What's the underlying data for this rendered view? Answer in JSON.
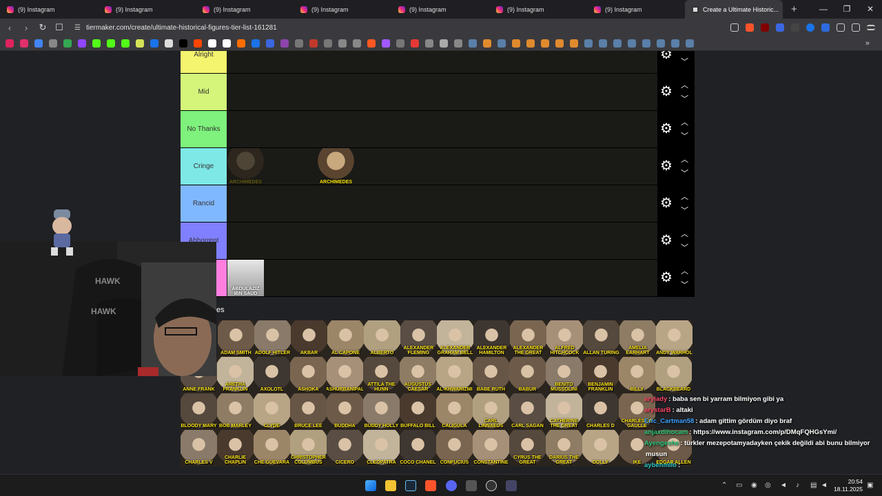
{
  "browser": {
    "tabs": [
      {
        "title": "(9) Instagram",
        "active": false
      },
      {
        "title": "(9) Instagram",
        "active": false
      },
      {
        "title": "(9) Instagram",
        "active": false
      },
      {
        "title": "(9) Instagram",
        "active": false
      },
      {
        "title": "(9) Instagram",
        "active": false
      },
      {
        "title": "(9) Instagram",
        "active": false
      },
      {
        "title": "(9) Instagram",
        "active": false
      },
      {
        "title": "Create a Ultimate Historic...",
        "active": true
      }
    ],
    "new_tab": "+",
    "url": "tiermaker.com/create/ultimate-historical-figures-tier-list-161281"
  },
  "tiers": [
    {
      "label": "Alright",
      "color": "#f4f46e"
    },
    {
      "label": "Mid",
      "color": "#d4f57a"
    },
    {
      "label": "No Thanks",
      "color": "#7ef27c"
    },
    {
      "label": "Cringe",
      "color": "#7ee8e6"
    },
    {
      "label": "Rancid",
      "color": "#80b8ff"
    },
    {
      "label": "Abhorrent",
      "color": "#8080ff"
    },
    {
      "label": "in",
      "color": "#ff7fe0"
    }
  ],
  "tier_items": {
    "cringe": [
      {
        "name": "ARCHIMEDES",
        "faded": true
      },
      {
        "name": "ARCHIMEDES",
        "faded": false
      }
    ],
    "last": [
      {
        "name": "ABDULAZIZ IBN SAUD"
      }
    ]
  },
  "pool_label": "es",
  "pool": [
    [
      "ADAM SMITH",
      "ADOLF HITLER",
      "AKBAR",
      "AL CAPONE",
      "ALBERTO",
      "ALEXANDER FLEMING",
      "ALEXANDER GRAHAM BELL",
      "ALEXANDER HAMILTON",
      "ALEXANDER THE GREAT",
      "ALFRED HITCHCOCK",
      "ALLAN TURING",
      "AMELIA EARHART",
      "ANDY WARHOL"
    ],
    [
      "ANNE FRANK",
      "ARETHA FRANKLIN",
      "AXOLOTL",
      "ASHOKA",
      "ASHURBANIPAL",
      "ATTILA THE HUNN",
      "AUGUSTUS CAESAR",
      "AL-KHWARIZMI",
      "BABE RUTH",
      "BABUR",
      "BENITO MUSSOLINI",
      "BENJAMIN FRANKLIN",
      "BILLY",
      "BLACKBEARD"
    ],
    [
      "BLOODY MARY",
      "BOB MARLEY",
      "CLYDE",
      "BRUCE LEE",
      "BUDDHA",
      "BUDDY HOLLY",
      "BUFFALO BILL",
      "CALIGULA",
      "CARL LINNAEUS",
      "CARL SAGAN",
      "CATHERINE THE GREAT",
      "CHARLES D",
      "CHARLES DE GAULLE"
    ],
    [
      "CHARLES V",
      "CHARLIE CHAPLIN",
      "CHE GUEVARA",
      "CHRISTOPHER COLUMBUS",
      "CICERO",
      "CLEOPATRA",
      "COCO CHANEL",
      "CONFUCIUS",
      "CONSTANTINE",
      "CYRUS THE GREAT",
      "DARIUS THE GREAT",
      "DOLLY",
      "IKE",
      "EDGAR ALLEN"
    ]
  ],
  "chat": [
    {
      "user": "arylady",
      "text": ": baba sen bi yarram bilmiyon gibi ya",
      "color": "#ff4466"
    },
    {
      "user": "arystarB",
      "text": ": altaki",
      "color": "#ff4466"
    },
    {
      "user": "Eric_Cartman58",
      "text": ": adam gittim gördüm diyo braf",
      "color": "#3aa0ff"
    },
    {
      "user": "anjaxdihocam",
      "text": ": https://www.instagram.com/p/DMqFQHGsYmi/",
      "color": "#2ac77a"
    },
    {
      "user": "Ayengeshe",
      "text": ": türkler mezepotamyadayken çekik değildi abi bunu bilmiyor",
      "color": "#2ac77a"
    },
    {
      "user": "",
      "text": "musun",
      "color": "#fff"
    },
    {
      "user": "aybenmilo",
      "text": ":",
      "color": "#2ac7c7"
    }
  ],
  "clock": {
    "time": "20:54",
    "date": "18.11.2025"
  },
  "webcam_brand": "HAWK"
}
